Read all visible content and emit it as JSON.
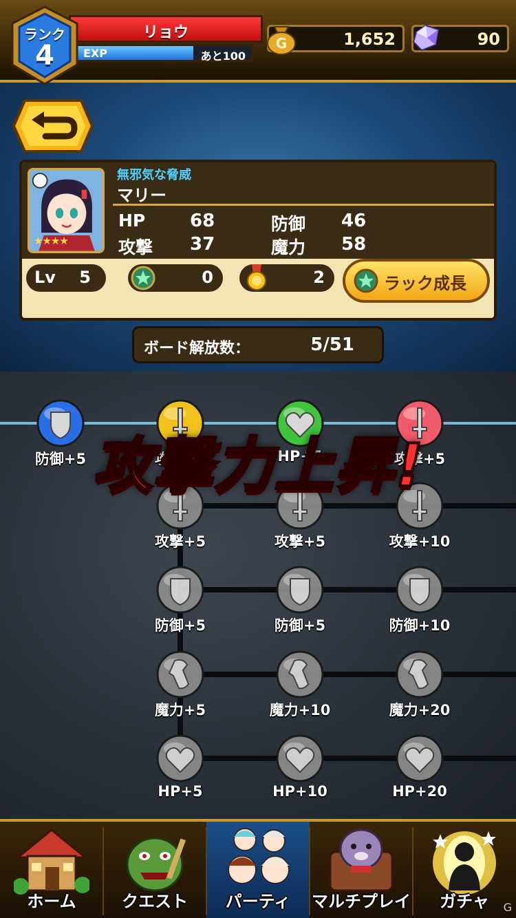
{
  "header": {
    "rank_label": "ランク",
    "rank_value": "4",
    "player_name": "リョウ",
    "exp_label": "EXP",
    "exp_remaining": "あと100",
    "exp_progress": 0.68,
    "gold": "1,652",
    "gems": "90"
  },
  "character": {
    "title": "無邪気な脅威",
    "name": "マリー",
    "stars": "★★★★",
    "stats": {
      "hp_label": "HP",
      "hp": "68",
      "def_label": "防御",
      "def": "46",
      "atk_label": "攻撃",
      "atk": "37",
      "mag_label": "魔力",
      "mag": "58"
    },
    "level_label": "Lv",
    "level": "5",
    "luck_stars": "0",
    "medals": "2",
    "luck_button": "ラック成長"
  },
  "board": {
    "count_label": "ボード解放数：",
    "count_value": "5/51",
    "banner": "攻撃力上昇!",
    "top_row": [
      {
        "label": "防御+5",
        "kind": "shield",
        "color": "#2a6ee6"
      },
      {
        "label": "攻撃+5",
        "kind": "sword",
        "color": "#f2c21a"
      },
      {
        "label": "HP+5",
        "kind": "heart",
        "color": "#3fc43c"
      },
      {
        "label": "攻撃+5",
        "kind": "sword",
        "color": "#f05a6a"
      }
    ],
    "rows": [
      [
        "攻撃+5",
        "攻撃+5",
        "攻撃+10"
      ],
      [
        "防御+5",
        "防御+5",
        "防御+10"
      ],
      [
        "魔力+5",
        "魔力+10",
        "魔力+20"
      ],
      [
        "HP+5",
        "HP+10",
        "HP+20"
      ]
    ]
  },
  "nav": {
    "items": [
      "ホーム",
      "クエスト",
      "パーティ",
      "マルチプレイ",
      "ガチャ"
    ],
    "active": "パーティ"
  },
  "watermark": "G"
}
